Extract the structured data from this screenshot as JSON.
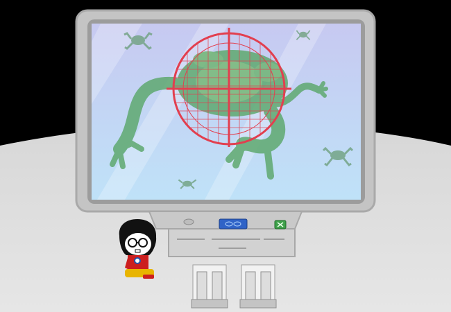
{
  "scene": {
    "colors": {
      "sky": "#000000",
      "floor": "#d9d9d9",
      "monitor_frame": "#c4c4c4",
      "monitor_inner": "#9a9a9a",
      "screen_top": "#c7c9f1",
      "screen_bottom": "#bfe0f7",
      "frog_green": "#5ea86f",
      "reticle_red": "#e23f4f",
      "console_blue": "#2f63c7",
      "console_green": "#3ea04a",
      "shirt_red": "#cc1f1f",
      "pants_yellow": "#e8b400"
    },
    "hologram": {
      "subject_icon": "giant-frog-icon",
      "small_frog_icons": [
        "small-frog-icon",
        "small-frog-icon",
        "small-frog-icon",
        "small-frog-icon"
      ]
    },
    "console": {
      "buttons": [
        {
          "icon": "frog-scan-icon",
          "color": "#2f63c7"
        },
        {
          "icon": "green-x-icon",
          "color": "#3ea04a"
        },
        {
          "icon": "knob-icon",
          "color": "#bdbdbd"
        }
      ]
    },
    "character": {
      "icon": "seated-kid-icon"
    }
  }
}
